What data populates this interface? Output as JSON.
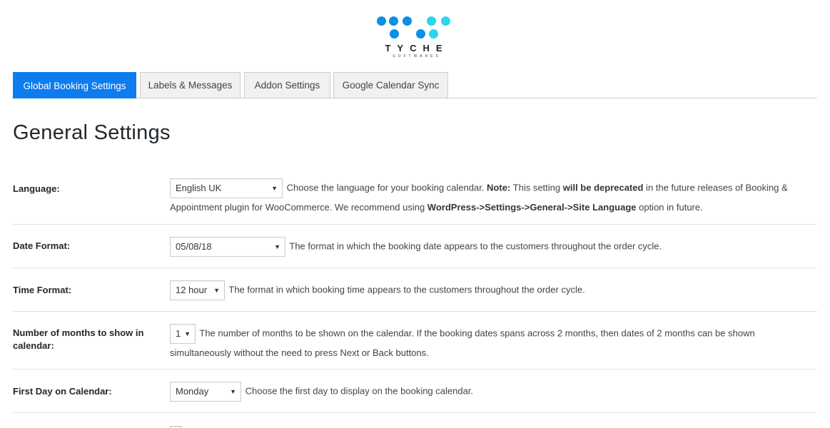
{
  "logo": {
    "brand": "TYCHE",
    "sub": "SOFTWARES",
    "colors": {
      "primary": "#0b8fe6",
      "secondary": "#2bd5f0"
    }
  },
  "tabs": [
    {
      "label": "Global Booking Settings",
      "active": true
    },
    {
      "label": "Labels & Messages",
      "active": false
    },
    {
      "label": "Addon Settings",
      "active": false
    },
    {
      "label": "Google Calendar Sync",
      "active": false
    }
  ],
  "page_title": "General Settings",
  "settings": {
    "language": {
      "label": "Language:",
      "value": "English UK",
      "desc_1": " Choose the language for your booking calendar. ",
      "note": "Note:",
      "desc_2": " This setting ",
      "bold_1": "will be deprecated",
      "desc_3": " in the future releases of Booking & Appointment plugin for WooCommerce. We recommend using ",
      "bold_2": "WordPress->Settings->General->Site Language",
      "desc_4": " option in future."
    },
    "date_format": {
      "label": "Date Format:",
      "value": "05/08/18",
      "desc": " The format in which the booking date appears to the customers throughout the order cycle."
    },
    "time_format": {
      "label": "Time Format:",
      "value": "12 hour",
      "desc": " The format in which booking time appears to the customers throughout the order cycle."
    },
    "months": {
      "label": "Number of months to show in calendar:",
      "value": "1",
      "desc": " The number of months to be shown on the calendar. If the booking dates spans across 2 months, then dates of 2 months can be shown simultaneously without the need to press Next or Back buttons."
    },
    "first_day": {
      "label": "First Day on Calendar:",
      "value": "Monday",
      "desc": " Choose the first day to display on the booking calendar."
    }
  },
  "accent_color": "#0c7cee"
}
